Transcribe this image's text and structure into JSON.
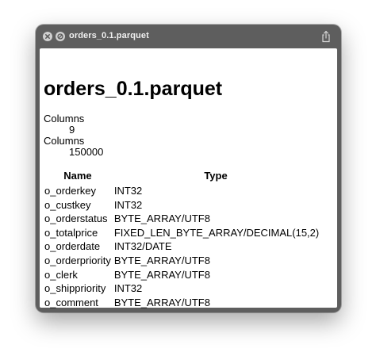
{
  "window": {
    "title": "orders_0.1.parquet",
    "icons": [
      "close-icon",
      "block-icon",
      "share-icon"
    ]
  },
  "document": {
    "heading": "orders_0.1.parquet",
    "stats": [
      {
        "label": "Columns",
        "value": "9"
      },
      {
        "label": "Columns",
        "value": "150000"
      }
    ],
    "schema": {
      "headers": [
        "Name",
        "Type"
      ],
      "rows": [
        {
          "name": "o_orderkey",
          "type": "INT32"
        },
        {
          "name": "o_custkey",
          "type": "INT32"
        },
        {
          "name": "o_orderstatus",
          "type": "BYTE_ARRAY/UTF8"
        },
        {
          "name": "o_totalprice",
          "type": "FIXED_LEN_BYTE_ARRAY/DECIMAL(15,2)"
        },
        {
          "name": "o_orderdate",
          "type": "INT32/DATE"
        },
        {
          "name": "o_orderpriority",
          "type": "BYTE_ARRAY/UTF8"
        },
        {
          "name": "o_clerk",
          "type": "BYTE_ARRAY/UTF8"
        },
        {
          "name": "o_shippriority",
          "type": "INT32"
        },
        {
          "name": "o_comment",
          "type": "BYTE_ARRAY/UTF8"
        }
      ]
    }
  },
  "colors": {
    "titlebar": "#5e5e5e",
    "title_text": "#f0f0f0",
    "content_bg": "#ffffff"
  }
}
